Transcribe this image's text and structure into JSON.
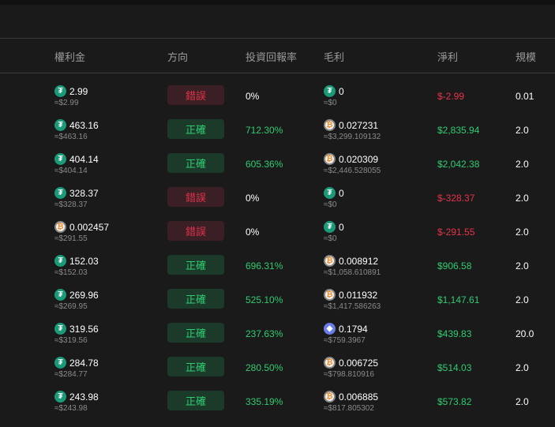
{
  "headers": [
    "權利金",
    "方向",
    "投資回報率",
    "毛利",
    "淨利",
    "規模"
  ],
  "rows": [
    {
      "premium": "2.99",
      "premium_usd": "≈$2.99",
      "premium_coin": "usdt",
      "direction": "錯誤",
      "dir_ok": false,
      "roi": "0%",
      "gross": "0",
      "gross_usd": "≈$0",
      "gross_coin": "usdt",
      "net": "$-2.99",
      "net_pos": false,
      "size": "0.01"
    },
    {
      "premium": "463.16",
      "premium_usd": "≈$463.16",
      "premium_coin": "usdt",
      "direction": "正確",
      "dir_ok": true,
      "roi": "712.30%",
      "gross": "0.027231",
      "gross_usd": "≈$3,299.109132",
      "gross_coin": "btc",
      "net": "$2,835.94",
      "net_pos": true,
      "size": "2.0"
    },
    {
      "premium": "404.14",
      "premium_usd": "≈$404.14",
      "premium_coin": "usdt",
      "direction": "正確",
      "dir_ok": true,
      "roi": "605.36%",
      "gross": "0.020309",
      "gross_usd": "≈$2,446.528055",
      "gross_coin": "btc",
      "net": "$2,042.38",
      "net_pos": true,
      "size": "2.0"
    },
    {
      "premium": "328.37",
      "premium_usd": "≈$328.37",
      "premium_coin": "usdt",
      "direction": "錯誤",
      "dir_ok": false,
      "roi": "0%",
      "gross": "0",
      "gross_usd": "≈$0",
      "gross_coin": "usdt",
      "net": "$-328.37",
      "net_pos": false,
      "size": "2.0"
    },
    {
      "premium": "0.002457",
      "premium_usd": "≈$291.55",
      "premium_coin": "btc",
      "direction": "錯誤",
      "dir_ok": false,
      "roi": "0%",
      "gross": "0",
      "gross_usd": "≈$0",
      "gross_coin": "usdt",
      "net": "$-291.55",
      "net_pos": false,
      "size": "2.0"
    },
    {
      "premium": "152.03",
      "premium_usd": "≈$152.03",
      "premium_coin": "usdt",
      "direction": "正確",
      "dir_ok": true,
      "roi": "696.31%",
      "gross": "0.008912",
      "gross_usd": "≈$1,058.610891",
      "gross_coin": "btc",
      "net": "$906.58",
      "net_pos": true,
      "size": "2.0"
    },
    {
      "premium": "269.96",
      "premium_usd": "≈$269.95",
      "premium_coin": "usdt",
      "direction": "正確",
      "dir_ok": true,
      "roi": "525.10%",
      "gross": "0.011932",
      "gross_usd": "≈$1,417.586263",
      "gross_coin": "btc",
      "net": "$1,147.61",
      "net_pos": true,
      "size": "2.0"
    },
    {
      "premium": "319.56",
      "premium_usd": "≈$319.56",
      "premium_coin": "usdt",
      "direction": "正確",
      "dir_ok": true,
      "roi": "237.63%",
      "gross": "0.1794",
      "gross_usd": "≈$759.3967",
      "gross_coin": "eth",
      "net": "$439.83",
      "net_pos": true,
      "size": "20.0"
    },
    {
      "premium": "284.78",
      "premium_usd": "≈$284.77",
      "premium_coin": "usdt",
      "direction": "正確",
      "dir_ok": true,
      "roi": "280.50%",
      "gross": "0.006725",
      "gross_usd": "≈$798.810916",
      "gross_coin": "btc",
      "net": "$514.03",
      "net_pos": true,
      "size": "2.0"
    },
    {
      "premium": "243.98",
      "premium_usd": "≈$243.98",
      "premium_coin": "usdt",
      "direction": "正確",
      "dir_ok": true,
      "roi": "335.19%",
      "gross": "0.006885",
      "gross_usd": "≈$817.805302",
      "gross_coin": "btc",
      "net": "$573.82",
      "net_pos": true,
      "size": "2.0"
    }
  ],
  "icons": {
    "usdt": "₮",
    "btc": "₿",
    "eth": "◆"
  },
  "colors": {
    "positive": "#2ecc71",
    "negative": "#e8334a"
  }
}
